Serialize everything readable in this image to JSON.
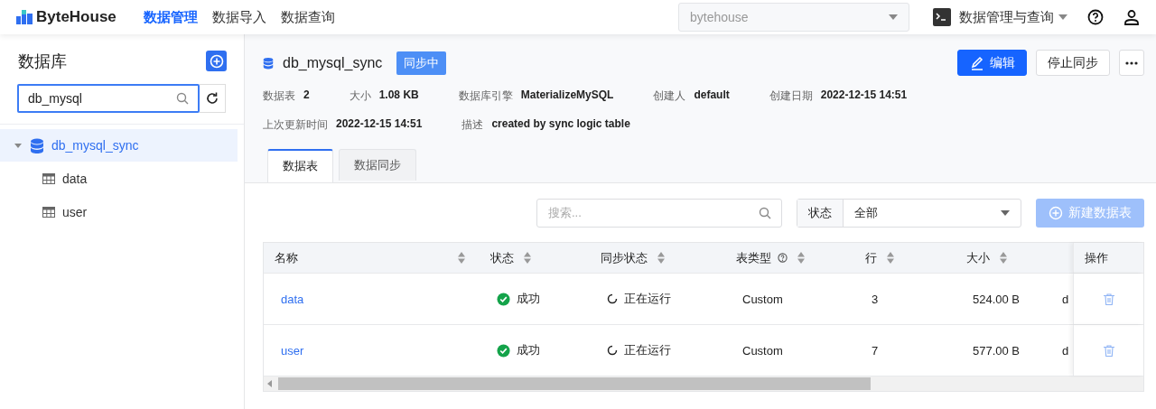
{
  "header": {
    "logo": "ByteHouse",
    "nav": [
      {
        "label": "数据管理",
        "selected": true
      },
      {
        "label": "数据导入",
        "selected": false
      },
      {
        "label": "数据查询",
        "selected": false
      }
    ],
    "cluster_select": {
      "placeholder": "bytehouse"
    },
    "workspace": "数据管理与查询"
  },
  "sidebar": {
    "title": "数据库",
    "search": {
      "value": "db_mysql"
    },
    "tree": [
      {
        "label": "db_mysql_sync",
        "expanded": true,
        "selected": true,
        "children": [
          {
            "label": "data"
          },
          {
            "label": "user"
          }
        ]
      }
    ]
  },
  "detail": {
    "name": "db_mysql_sync",
    "status": "同步中",
    "edit_button": "编辑",
    "stop_button": "停止同步",
    "info_rows": [
      [
        {
          "label": "数据表",
          "value": "2"
        },
        {
          "label": "大小",
          "value": "1.08 KB"
        },
        {
          "label": "数据库引擎",
          "value": "MaterializeMySQL"
        },
        {
          "label": "创建人",
          "value": "default"
        },
        {
          "label": "创建日期",
          "value": "2022-12-15 14:51"
        }
      ],
      [
        {
          "label": "上次更新时间",
          "value": "2022-12-15 14:51"
        },
        {
          "label": "描述",
          "value": "created by sync logic table"
        }
      ]
    ],
    "tabs": [
      {
        "label": "数据表",
        "selected": true
      },
      {
        "label": "数据同步",
        "selected": false
      }
    ]
  },
  "toolbar": {
    "search": {
      "placeholder": "搜索..."
    },
    "filter": {
      "label": "状态",
      "value": "全部"
    },
    "create_button": {
      "label": "新建数据表",
      "disabled": true
    }
  },
  "table": {
    "columns": [
      {
        "label": "名称",
        "help": false
      },
      {
        "label": "状态",
        "help": false
      },
      {
        "label": "同步状态",
        "help": false
      },
      {
        "label": "表类型",
        "help": true
      },
      {
        "label": "行",
        "help": false
      },
      {
        "label": "大小",
        "help": false
      }
    ],
    "action_column": "操作",
    "rows": [
      {
        "name": "data",
        "status": "成功",
        "sync_status": "正在运行",
        "type": "Custom",
        "row_count": "3",
        "size": "524.00 B",
        "column_7": "d"
      },
      {
        "name": "user",
        "status": "成功",
        "sync_status": "正在运行",
        "type": "Custom",
        "row_count": "7",
        "size": "577.00 B",
        "column_7": "d"
      }
    ]
  }
}
